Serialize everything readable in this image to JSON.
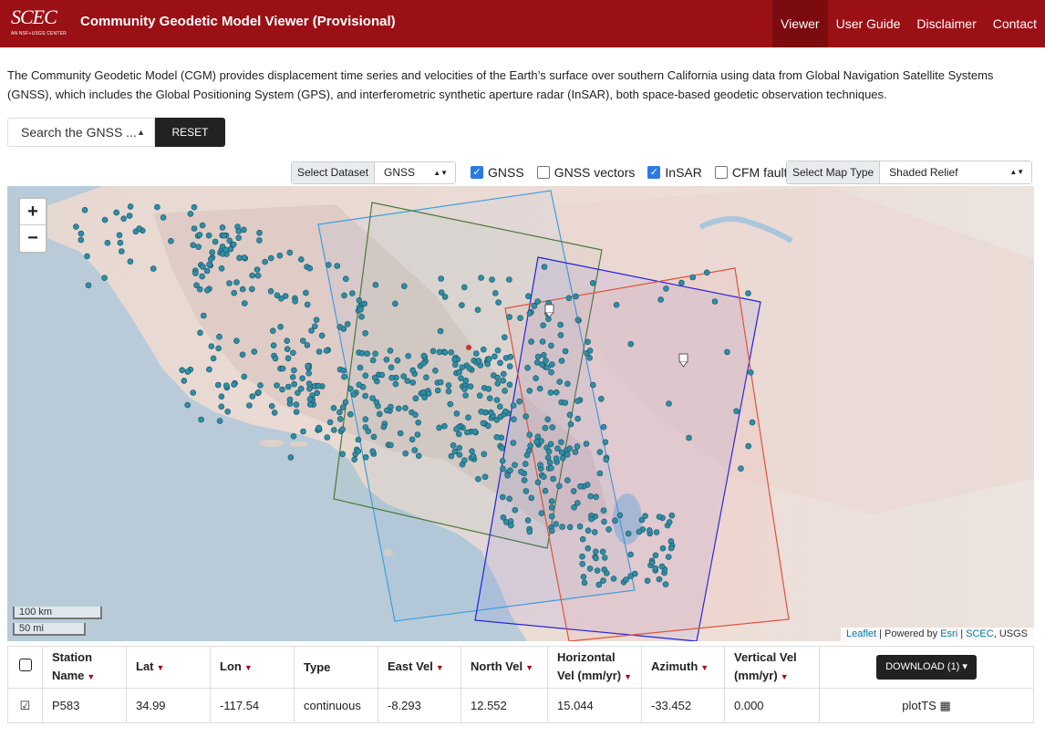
{
  "header": {
    "logo_text": "SCEC",
    "logo_subtext": "AN NSF+USGS CENTER",
    "title": "Community Geodetic Model Viewer (Provisional)",
    "nav": [
      {
        "label": "Viewer",
        "active": true
      },
      {
        "label": "User Guide",
        "active": false
      },
      {
        "label": "Disclaimer",
        "active": false
      },
      {
        "label": "Contact",
        "active": false
      }
    ]
  },
  "intro": "The Community Geodetic Model (CGM) provides displacement time series and velocities of the Earth’s surface over southern California using data from Global Navigation Satellite Systems (GNSS), which includes the Global Positioning System (GPS), and interferometric synthetic aperture radar (InSAR), both space-based geodetic observation techniques.",
  "search": {
    "selected": "Search the GNSS ...",
    "reset_label": "RESET"
  },
  "controls": {
    "dataset_label": "Select Dataset",
    "dataset_value": "GNSS",
    "checkboxes": [
      {
        "label": "GNSS",
        "checked": true
      },
      {
        "label": "GNSS vectors",
        "checked": false
      },
      {
        "label": "InSAR",
        "checked": true
      },
      {
        "label": "CFM faults",
        "checked": false
      }
    ],
    "maptype_label": "Select Map Type",
    "maptype_value": "Shaded Relief"
  },
  "map": {
    "zoom_in": "+",
    "zoom_out": "−",
    "scale_km": "100 km",
    "scale_mi": "50 mi",
    "attribution": {
      "leaflet": "Leaflet",
      "powered": " | Powered by ",
      "esri": "Esri",
      "sep": " | ",
      "scec": "SCEC",
      "usgs": ", USGS"
    },
    "colors": {
      "station": "#2c8fa8",
      "selected_station": "#c0392b",
      "insar_frames": [
        "#3aa0e0",
        "#4a7a3a",
        "#2222dd",
        "#e0533a"
      ]
    }
  },
  "table": {
    "headers": {
      "station": "Station Name",
      "lat": "Lat",
      "lon": "Lon",
      "type": "Type",
      "east": "East Vel",
      "north": "North Vel",
      "horizontal": "Horizontal Vel (mm/yr)",
      "azimuth": "Azimuth",
      "vertical": "Vertical Vel (mm/yr)",
      "download": "DOWNLOAD (1)"
    },
    "rows": [
      {
        "station": "P583",
        "lat": "34.99",
        "lon": "-117.54",
        "type": "continuous",
        "east": "-8.293",
        "north": "12.552",
        "horizontal": "15.044",
        "azimuth": "-33.452",
        "vertical": "0.000",
        "plot": "plotTS"
      }
    ]
  }
}
